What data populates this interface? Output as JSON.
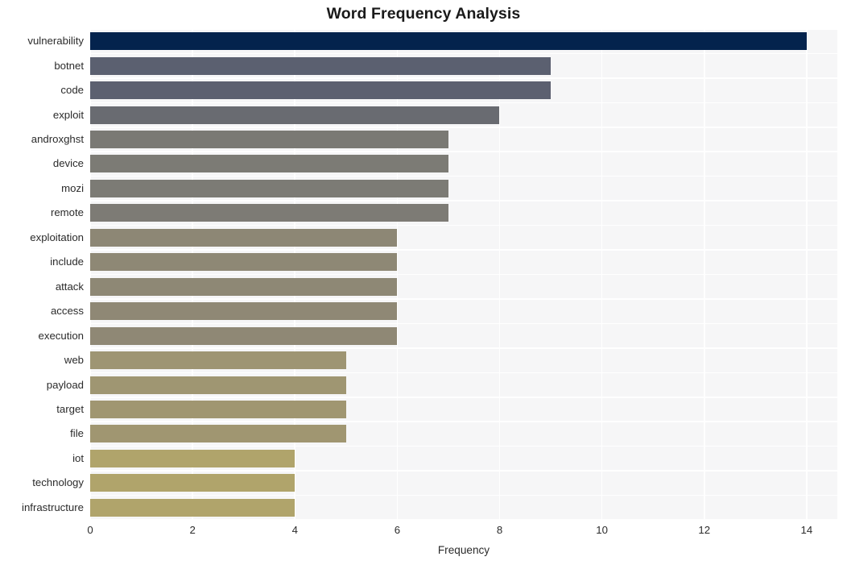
{
  "chart_data": {
    "type": "bar",
    "orientation": "horizontal",
    "title": "Word Frequency Analysis",
    "xlabel": "Frequency",
    "ylabel": "",
    "categories": [
      "vulnerability",
      "botnet",
      "code",
      "exploit",
      "androxghst",
      "device",
      "mozi",
      "remote",
      "exploitation",
      "include",
      "attack",
      "access",
      "execution",
      "web",
      "payload",
      "target",
      "file",
      "iot",
      "technology",
      "infrastructure"
    ],
    "values": [
      14,
      9,
      9,
      8,
      7,
      7,
      7,
      7,
      6,
      6,
      6,
      6,
      6,
      5,
      5,
      5,
      5,
      4,
      4,
      4
    ],
    "bar_colors": [
      "#04234d",
      "#5b6070",
      "#5c6070",
      "#696b71",
      "#7a7974",
      "#7c7b75",
      "#7c7b75",
      "#7d7b75",
      "#8d8775",
      "#8e8875",
      "#8e8875",
      "#8f8875",
      "#8f8875",
      "#9e9573",
      "#9f9672",
      "#a09671",
      "#a09671",
      "#b0a46b",
      "#b0a46b",
      "#b0a46b"
    ],
    "xticks": [
      0,
      2,
      4,
      6,
      8,
      10,
      12,
      14
    ],
    "xlim": [
      0,
      14.6
    ],
    "grid": true,
    "legend": false,
    "plot_background": "#f6f6f7",
    "gridline_color": "#ffffff",
    "figure_background": "#ffffff"
  }
}
